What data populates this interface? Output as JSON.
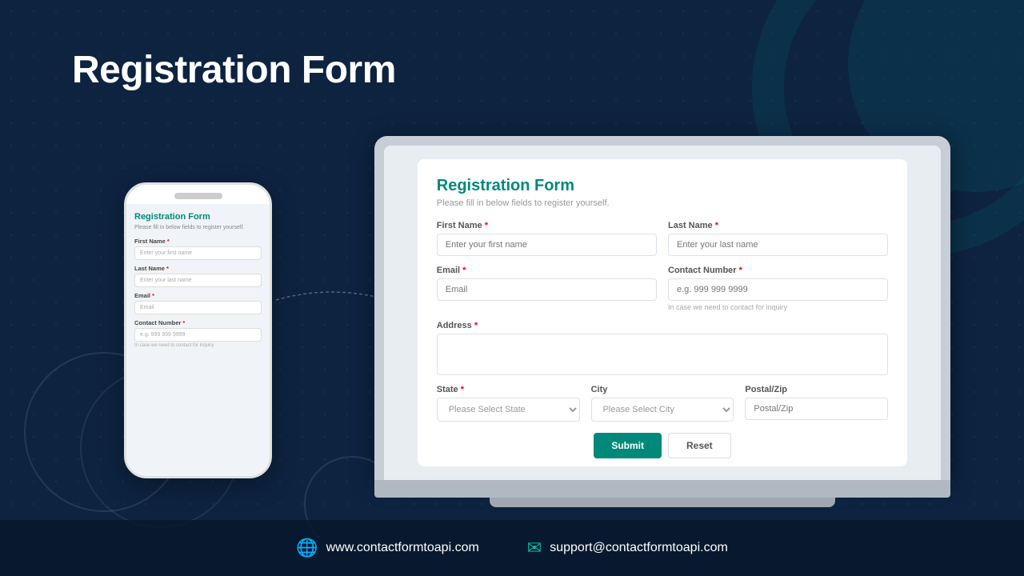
{
  "page": {
    "title": "Registration Form",
    "bg_color": "#0d2340"
  },
  "main_title": "Registration Form",
  "phone": {
    "form_title": "Registration Form",
    "form_subtitle": "Please fill in below fields to register yourself.",
    "fields": [
      {
        "label": "First Name",
        "required": true,
        "placeholder": "Enter your first name"
      },
      {
        "label": "Last Name",
        "required": true,
        "placeholder": "Enter your last name"
      },
      {
        "label": "Email",
        "required": true,
        "placeholder": "Email"
      },
      {
        "label": "Contact Number",
        "required": true,
        "placeholder": "e.g. 999 999 9999",
        "hint": "In case we need to contact for inquiry"
      }
    ]
  },
  "form": {
    "title": "Registration Form",
    "subtitle": "Please fill in below fields to register yourself.",
    "first_name_label": "First Name *",
    "first_name_placeholder": "Enter your first name",
    "last_name_label": "Last Name *",
    "last_name_placeholder": "Enter your last name",
    "email_label": "Email *",
    "email_placeholder": "Email",
    "contact_label": "Contact Number *",
    "contact_placeholder": "e.g. 999 999 9999",
    "contact_hint": "In case we need to contact for inquiry",
    "address_label": "Address *",
    "state_label": "State *",
    "state_default": "Please Select State",
    "city_label": "City",
    "city_default": "Please Select City",
    "postal_label": "Postal/Zip",
    "postal_placeholder": "Postal/Zip",
    "submit_label": "Submit",
    "reset_label": "Reset"
  },
  "footer": {
    "website": "www.contactformtoapi.com",
    "email": "support@contactformtoapi.com"
  }
}
